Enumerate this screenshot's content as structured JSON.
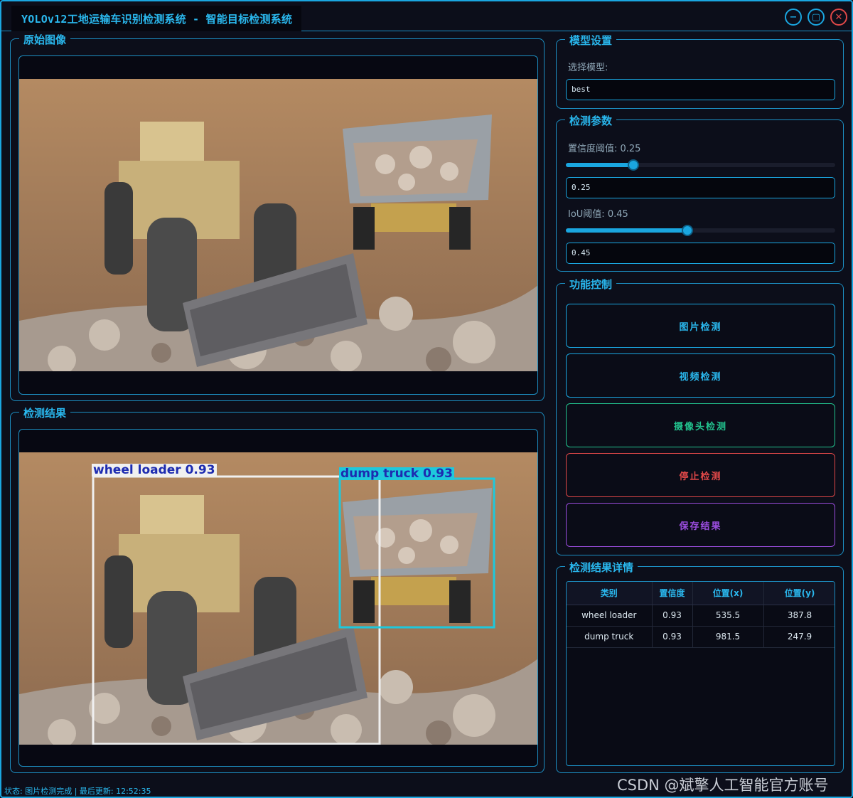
{
  "window": {
    "title": "YOLOv12工地运输车识别检测系统 - 智能目标检测系统"
  },
  "titlebar_buttons": {
    "minimize": "−",
    "maximize": "▢",
    "close": "✕"
  },
  "original_panel": {
    "label": "原始图像"
  },
  "result_panel": {
    "label": "检测结果",
    "detections": [
      {
        "text": "wheel loader 0.93",
        "color": "#f0f0f0"
      },
      {
        "text": "dump truck 0.93",
        "color": "#1ec8dc"
      }
    ]
  },
  "model": {
    "label": "模型设置",
    "select_label": "选择模型:",
    "selected": "best"
  },
  "params": {
    "label": "检测参数",
    "conf_label": "置信度阈值: 0.25",
    "conf_value": "0.25",
    "conf_fraction": 0.25,
    "iou_label": "IoU阈值: 0.45",
    "iou_value": "0.45",
    "iou_fraction": 0.45
  },
  "controls": {
    "label": "功能控制",
    "image_detect": "图片检测",
    "video_detect": "视频检测",
    "camera_detect": "摄像头检测",
    "stop_detect": "停止检测",
    "save_result": "保存结果",
    "colors": {
      "image": "#1aa6e0",
      "video": "#1aa6e0",
      "camera": "#22c38e",
      "stop": "#e04848",
      "save": "#9b4ddf"
    }
  },
  "details": {
    "label": "检测结果详情",
    "columns": [
      "类别",
      "置信度",
      "位置(x)",
      "位置(y)"
    ],
    "rows": [
      [
        "wheel loader",
        "0.93",
        "535.5",
        "387.8"
      ],
      [
        "dump truck",
        "0.93",
        "981.5",
        "247.9"
      ]
    ]
  },
  "statusbar": {
    "text": "状态: 图片检测完成 | 最后更新: 12:52:35"
  },
  "watermark": "CSDN @斌擎人工智能官方账号"
}
